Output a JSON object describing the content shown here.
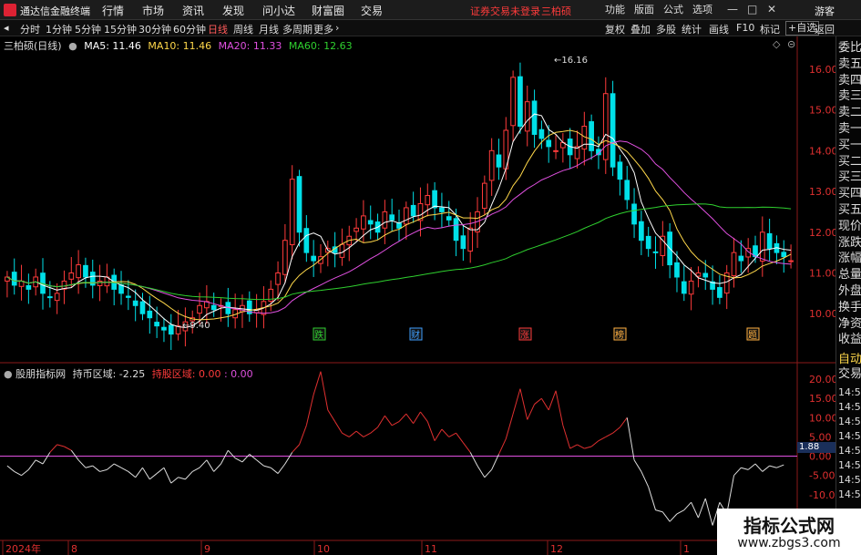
{
  "titlebar": {
    "app_title": "通达信金融终端",
    "menus": [
      "行情",
      "市场",
      "资讯",
      "发现",
      "问小达",
      "财富圈",
      "交易"
    ],
    "alert": "证券交易未登录",
    "stock_name": "三柏硕",
    "tools": [
      "功能",
      "版面",
      "公式",
      "选项"
    ],
    "guest": "游客"
  },
  "timeframes": {
    "items": [
      "分时",
      "1分钟",
      "5分钟",
      "15分钟",
      "30分钟",
      "60分钟",
      "日线",
      "周线",
      "月线",
      "多周期",
      "更多"
    ],
    "active": "日线",
    "right_buttons": [
      "复权",
      "叠加",
      "多股",
      "统计",
      "画线",
      "F10",
      "标记",
      "+自选",
      "返回"
    ]
  },
  "main_legend": {
    "stock": "三柏硕(日线)",
    "ma": [
      {
        "label": "MA5: 11.46",
        "color": "#ffffff"
      },
      {
        "label": "MA10: 11.46",
        "color": "#ffd84a"
      },
      {
        "label": "MA20: 11.33",
        "color": "#e050e0"
      },
      {
        "label": "MA60: 12.63",
        "color": "#2fd02f"
      }
    ]
  },
  "indicator_legend": {
    "name": "股朋指标网",
    "line1": "持币区域: -2.25",
    "line2": "持股区域: 0.00",
    "line3": ": 0.00",
    "line1_color": "#dddddd",
    "line2_color": "#ff3b3b",
    "line3_color": "#e050e0"
  },
  "price_axis": [
    "16.00",
    "15.00",
    "14.00",
    "13.00",
    "12.00",
    "11.00",
    "10.00"
  ],
  "indicator_axis": [
    "20.00",
    "15.00",
    "10.00",
    "5.00",
    "0.00",
    "-5.00",
    "-10.00"
  ],
  "indicator_value_box": "1.88",
  "annotations": {
    "high": "16.16",
    "low": "9.40"
  },
  "event_markers": [
    {
      "label": "跌",
      "color": "#2fd02f"
    },
    {
      "label": "财",
      "color": "#3fa0ff"
    },
    {
      "label": "涨",
      "color": "#ff3b3b"
    },
    {
      "label": "榜",
      "color": "#ffb040"
    },
    {
      "label": "题",
      "color": "#ffb040"
    }
  ],
  "date_axis": [
    "2024年",
    "8",
    "9",
    "10",
    "11",
    "12",
    "1"
  ],
  "side_panel": {
    "items": [
      "委比",
      "卖五",
      "卖四",
      "卖三",
      "卖二",
      "卖一",
      "买一",
      "买二",
      "买三",
      "买四",
      "买五",
      "现价",
      "涨跌",
      "涨幅",
      "总量",
      "外盘",
      "换手",
      "净资",
      "收益"
    ],
    "tab": "自动",
    "tab2": "交易",
    "trade_times": [
      "14:56",
      "14:56",
      "14:56",
      "14:56",
      "14:56",
      "14:56",
      "14:56",
      "14:56"
    ]
  },
  "watermark": {
    "title": "指标公式网",
    "url": "www.zbgs3.com"
  },
  "colors": {
    "up": "#ff3b3b",
    "down": "#00e0e8",
    "ma5": "#ffffff",
    "ma10": "#ffd84a",
    "ma20": "#e050e0",
    "ma60": "#2fd02f",
    "zero_line": "#e050e0",
    "grid": "#8b1a1a"
  },
  "chart_data": {
    "type": "candlestick",
    "y_range": [
      9.2,
      16.4
    ],
    "x_labels": [
      "2024年",
      "8",
      "9",
      "10",
      "11",
      "12",
      "1"
    ],
    "close_series": [
      10.9,
      10.7,
      10.8,
      10.6,
      10.9,
      10.5,
      10.4,
      10.5,
      10.8,
      11.0,
      11.2,
      10.9,
      10.7,
      10.8,
      10.9,
      10.6,
      10.5,
      10.4,
      10.2,
      10.0,
      9.9,
      9.7,
      9.6,
      9.5,
      9.7,
      9.8,
      9.9,
      10.2,
      10.3,
      10.1,
      10.2,
      10.0,
      10.1,
      10.2,
      10.0,
      10.1,
      10.3,
      10.6,
      11.0,
      11.8,
      13.3,
      12.0,
      11.5,
      11.3,
      11.4,
      11.6,
      11.5,
      11.7,
      11.9,
      12.1,
      12.4,
      12.2,
      12.0,
      12.5,
      12.3,
      12.1,
      12.6,
      12.4,
      12.7,
      12.9,
      12.6,
      12.5,
      12.3,
      11.8,
      11.6,
      12.1,
      12.5,
      13.2,
      14.0,
      13.6,
      14.5,
      15.8,
      14.6,
      15.2,
      14.4,
      14.3,
      14.1,
      14.0,
      14.2,
      13.9,
      14.1,
      14.6,
      14.0,
      13.9,
      15.4,
      13.6,
      13.3,
      12.8,
      12.2,
      11.8,
      11.6,
      11.5,
      11.9,
      11.2,
      10.9,
      10.5,
      10.8,
      11.0,
      10.9,
      10.6,
      10.4,
      11.0,
      11.5,
      11.3,
      11.6,
      11.4,
      12.0,
      11.6,
      11.5,
      11.4,
      11.3
    ],
    "indicator_series": [
      -2.5,
      -4.0,
      -5.0,
      -3.5,
      -1.0,
      -2.0,
      1.0,
      3.0,
      2.5,
      1.5,
      -1.0,
      -3.0,
      -2.5,
      -4.0,
      -3.5,
      -2.0,
      -3.0,
      -4.0,
      -5.5,
      -3.0,
      -6.0,
      -4.5,
      -3.0,
      -7.0,
      -5.5,
      -6.0,
      -4.0,
      -3.0,
      -1.0,
      -4.0,
      -2.0,
      1.5,
      -0.5,
      -1.5,
      0.5,
      -1.0,
      -2.5,
      -3.0,
      -4.5,
      -2.0,
      1.0,
      3.0,
      8.0,
      16.0,
      22.0,
      12.0,
      9.0,
      6.0,
      5.0,
      6.5,
      5.0,
      6.0,
      7.5,
      10.5,
      8.0,
      9.0,
      11.0,
      8.5,
      11.5,
      9.0,
      4.0,
      7.0,
      5.0,
      6.0,
      3.5,
      1.0,
      -2.5,
      -5.5,
      -3.5,
      0.5,
      4.5,
      11.0,
      17.5,
      9.5,
      13.5,
      15.0,
      12.0,
      17.0,
      8.0,
      2.0,
      3.0,
      2.0,
      2.5,
      4.0,
      5.0,
      6.0,
      7.5,
      10.0,
      -1.0,
      -4.0,
      -8.0,
      -14.0,
      -14.5,
      -17.0,
      -15.0,
      -14.0,
      -12.0,
      -16.0,
      -11.0,
      -18.0,
      -12.0,
      -15.0,
      -5.0,
      -3.0,
      -3.5,
      -2.0,
      -4.0,
      -2.5,
      -3.0,
      -2.25
    ]
  }
}
